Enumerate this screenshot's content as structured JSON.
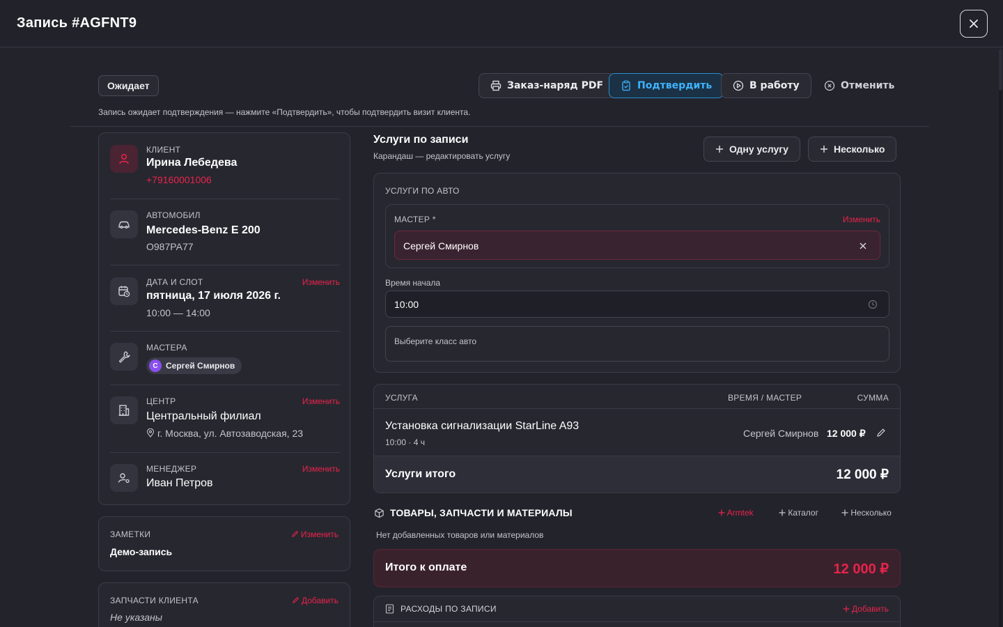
{
  "header": {
    "title": "Запись #AGFNT9"
  },
  "status": {
    "badge": "Ожидает",
    "hint": "Запись ожидает подтверждения — нажмите «Подтвердить», чтобы подтвердить визит клиента."
  },
  "actions": {
    "pdf": "Заказ-наряд PDF",
    "confirm": "Подтвердить",
    "to_work": "В работу",
    "cancel": "Отменить"
  },
  "client": {
    "label": "КЛИЕНТ",
    "name": "Ирина Лебедева",
    "phone": "+79160001006"
  },
  "car": {
    "label": "АВТОМОБИЛ",
    "model": "Mercedes-Benz E 200",
    "plate": "О987РА77"
  },
  "slot": {
    "label": "ДАТА И СЛОТ",
    "change": "Изменить",
    "date": "пятница, 17 июля 2026 г.",
    "time": "10:00 — 14:00"
  },
  "masters": {
    "label": "МАСТЕРА",
    "chip_initial": "С",
    "chip_name": "Сергей Смирнов"
  },
  "center": {
    "label": "ЦЕНТР",
    "change": "Изменить",
    "name": "Центральный филиал",
    "address": "г. Москва, ул. Автозаводская, 23"
  },
  "manager": {
    "label": "МЕНЕДЖЕР",
    "change": "Изменить",
    "name": "Иван Петров"
  },
  "notes": {
    "label": "ЗАМЕТКИ",
    "change": "Изменить",
    "text": "Демо-запись"
  },
  "client_parts": {
    "label": "ЗАПЧАСТИ КЛИЕНТА",
    "add": "Добавить",
    "text": "Не указаны"
  },
  "services": {
    "title": "Услуги по записи",
    "subtitle": "Карандаш — редактировать услугу",
    "add_one": "Одну услугу",
    "add_many": "Несколько",
    "by_car_label": "УСЛУГИ ПО АВТО",
    "master_label": "МАСТЕР *",
    "master_change": "Изменить",
    "master_value": "Сергей Смирнов",
    "start_label": "Время начала",
    "start_value": "10:00",
    "class_placeholder": "Выберите класс авто",
    "table_headers": {
      "service": "УСЛУГА",
      "time_master": "ВРЕМЯ / МАСТЕР",
      "sum": "СУММА"
    },
    "rows": [
      {
        "name": "Установка сигнализации StarLine A93",
        "meta": "10:00 · 4 ч",
        "master": "Сергей Смирнов",
        "sum": "12 000 ₽"
      }
    ],
    "total_label": "Услуги итого",
    "total_value": "12 000 ₽"
  },
  "goods": {
    "title": "ТОВАРЫ, ЗАПЧАСТИ И МАТЕРИАЛЫ",
    "armtek": "Armtek",
    "catalog": "Каталог",
    "many": "Несколько",
    "empty": "Нет добавленных товаров или материалов"
  },
  "payment": {
    "label": "Итого к оплате",
    "value": "12 000 ₽"
  },
  "expenses": {
    "title": "РАСХОДЫ ПО ЗАПИСИ",
    "add": "Добавить"
  },
  "colors": {
    "accent_red": "#e8244a",
    "accent_blue": "#3fb3ff",
    "background": "#23232c"
  }
}
